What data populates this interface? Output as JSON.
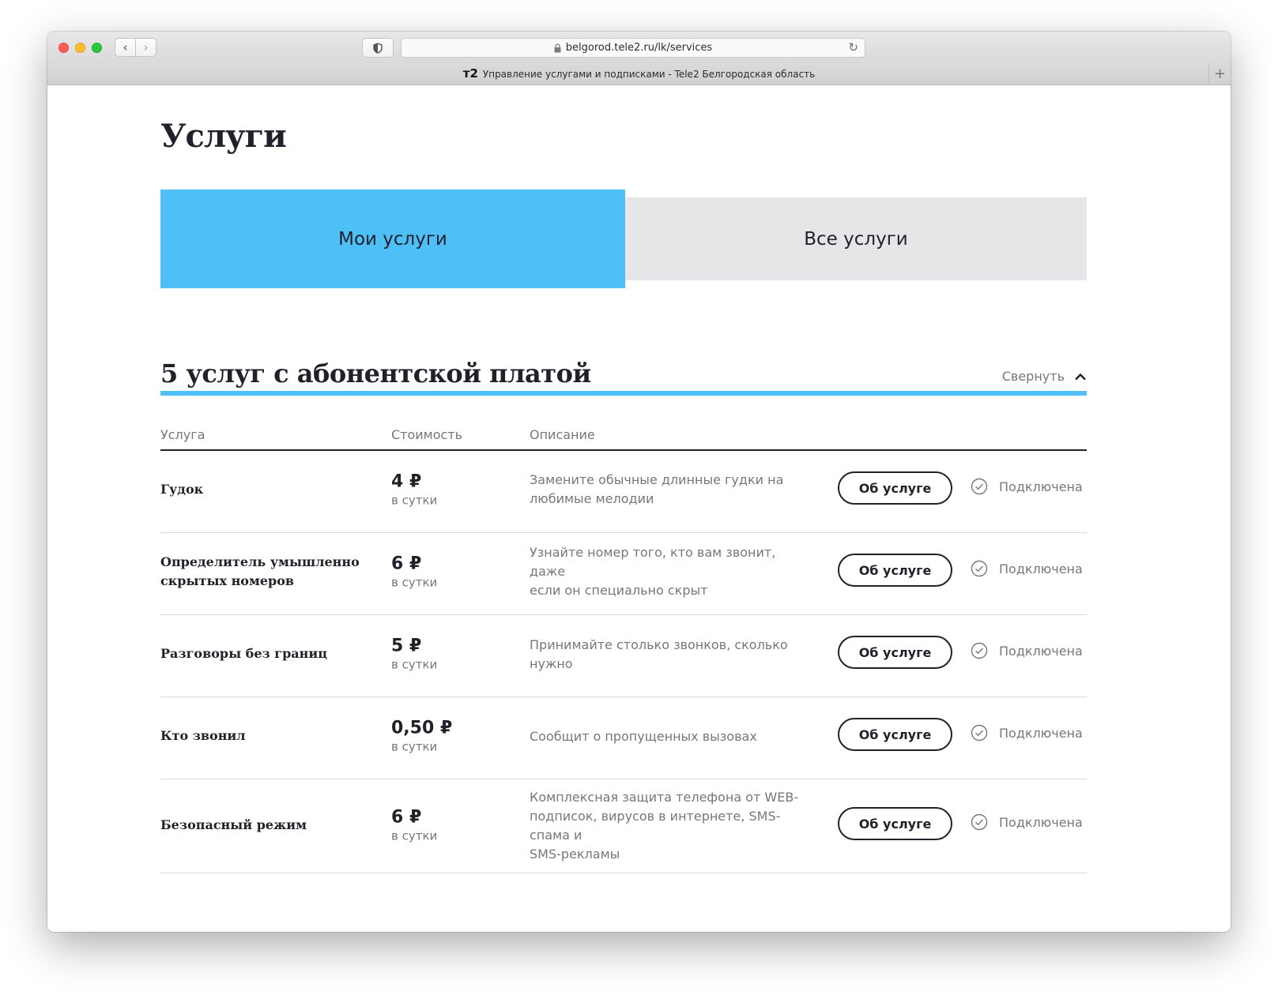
{
  "browser": {
    "url": "belgorod.tele2.ru/lk/services",
    "tab_logo": "т2",
    "tab_title": "Управление услугами и подписками - Tele2 Белгородская область",
    "new_tab_label": "+"
  },
  "page": {
    "title": "Услуги",
    "tabs": [
      {
        "label": "Мои услуги",
        "active": true
      },
      {
        "label": "Все услуги",
        "active": false
      }
    ]
  },
  "section": {
    "title": "5 услуг с абонентской платой",
    "collapse_label": "Свернуть",
    "columns": [
      "Услуга",
      "Стоимость",
      "Описание"
    ],
    "rows": [
      {
        "name_lines": [
          "Гудок"
        ],
        "price": "4 ₽",
        "period": "в сутки",
        "desc_lines": [
          "Замените обычные длинные гудки на",
          "любимые мелодии"
        ],
        "button": "Об услуге",
        "status": "Подключена"
      },
      {
        "name_lines": [
          "Определитель умышленно",
          "скрытых номеров"
        ],
        "price": "6 ₽",
        "period": "в сутки",
        "desc_lines": [
          "Узнайте номер того, кто вам звонит, даже",
          "если он специально скрыт"
        ],
        "button": "Об услуге",
        "status": "Подключена"
      },
      {
        "name_lines": [
          "Разговоры без границ"
        ],
        "price": "5 ₽",
        "period": "в сутки",
        "desc_lines": [
          "Принимайте столько звонков, сколько нужно"
        ],
        "button": "Об услуге",
        "status": "Подключена"
      },
      {
        "name_lines": [
          "Кто звонил"
        ],
        "price": "0,50 ₽",
        "period": "в сутки",
        "desc_lines": [
          "Сообщит о пропущенных вызовах"
        ],
        "button": "Об услуге",
        "status": "Подключена"
      },
      {
        "name_lines": [
          "Безопасный режим"
        ],
        "price": "6 ₽",
        "period": "в сутки",
        "desc_lines": [
          "Комплексная защита телефона от WEB-",
          "подписок, вирусов в интернете, SMS-спама и",
          "SMS-рекламы"
        ],
        "button": "Об услуге",
        "status": "Подключена"
      }
    ]
  },
  "colors": {
    "accent": "#4ebff7",
    "tab_inactive": "#e6e6e9",
    "text_dark": "#1f2229",
    "text_muted": "#74777d"
  }
}
